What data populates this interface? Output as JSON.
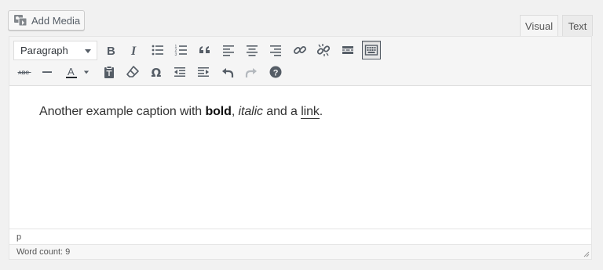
{
  "media": {
    "add_media_label": "Add Media"
  },
  "tabs": {
    "visual_label": "Visual",
    "text_label": "Text"
  },
  "toolbar": {
    "format_select_value": "Paragraph",
    "row1_icons": [
      "bold-icon",
      "italic-icon",
      "bulleted-list-icon",
      "numbered-list-icon",
      "blockquote-icon",
      "align-left-icon",
      "align-center-icon",
      "align-right-icon",
      "insert-link-icon",
      "remove-link-icon",
      "read-more-icon",
      "toolbar-toggle-icon"
    ],
    "row2_icons": [
      "strikethrough-icon",
      "horizontal-line-icon",
      "text-color-icon",
      "paste-as-text-icon",
      "clear-formatting-icon",
      "special-character-icon",
      "decrease-indent-icon",
      "increase-indent-icon",
      "undo-icon",
      "redo-icon",
      "help-icon"
    ]
  },
  "content": {
    "text_before": "Another example caption with ",
    "bold_text": "bold",
    "text_comma": ", ",
    "italic_text": "italic",
    "text_and": " and a ",
    "link_text": "link",
    "text_end": "."
  },
  "path_bar": {
    "path": "p"
  },
  "status": {
    "word_count": "Word count: 9"
  },
  "colors": {
    "background": "#f1f1f1",
    "toolbar": "#f5f5f5",
    "icon": "#555d66",
    "editor": "#ffffff"
  }
}
